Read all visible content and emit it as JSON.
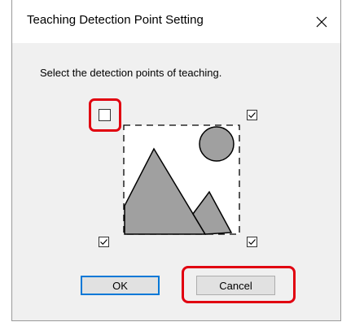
{
  "dialog": {
    "title": "Teaching Detection Point Setting",
    "close_icon": "close-icon",
    "instruction": "Select the detection points of teaching."
  },
  "checkboxes": {
    "top_left": {
      "checked": false
    },
    "top_right": {
      "checked": true
    },
    "bottom_left": {
      "checked": true
    },
    "bottom_right": {
      "checked": true
    }
  },
  "picture_icon": "image-placeholder-icon",
  "buttons": {
    "ok": "OK",
    "cancel": "Cancel"
  },
  "colors": {
    "highlight": "#e10010",
    "default_button_border": "#0078d7",
    "shape_fill": "#a0a0a0"
  }
}
